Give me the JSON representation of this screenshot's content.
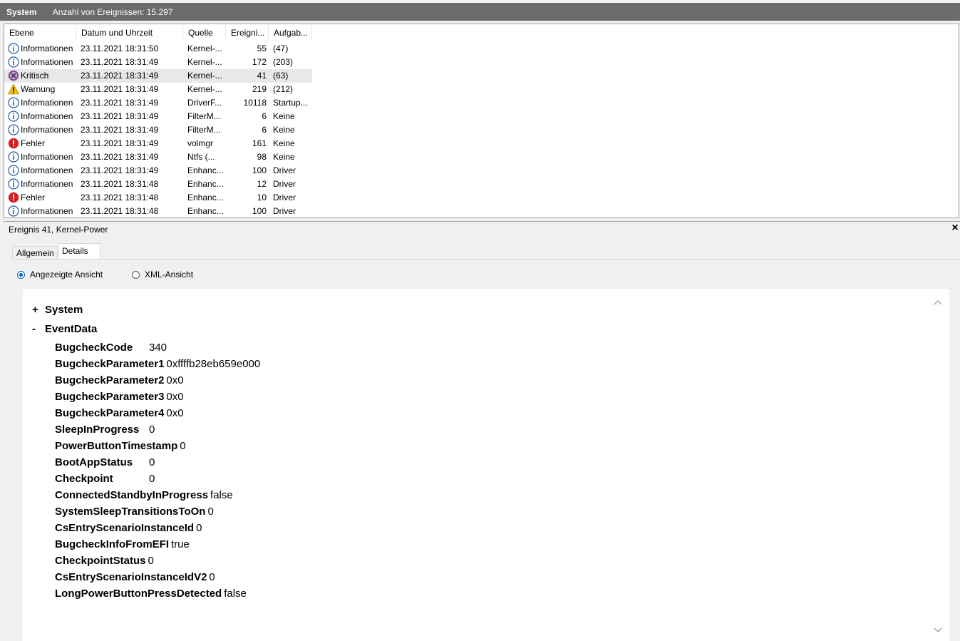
{
  "titlebar": {
    "name": "System",
    "count": "Anzahl von Ereignissen: 15.297"
  },
  "columns": [
    "Ebene",
    "Datum und Uhrzeit",
    "Quelle",
    "Ereigni...",
    "Aufgab..."
  ],
  "rows": [
    {
      "icon": "info-icon",
      "level": "Informationen",
      "date": "23.11.2021 18:31:50",
      "source": "Kernel-...",
      "id": "55",
      "task": "(47)"
    },
    {
      "icon": "info-icon",
      "level": "Informationen",
      "date": "23.11.2021 18:31:49",
      "source": "Kernel-...",
      "id": "172",
      "task": "(203)"
    },
    {
      "icon": "critical-icon",
      "level": "Kritisch",
      "date": "23.11.2021 18:31:49",
      "source": "Kernel-...",
      "id": "41",
      "task": "(63)",
      "selected": true
    },
    {
      "icon": "warning-icon",
      "level": "Warnung",
      "date": "23.11.2021 18:31:49",
      "source": "Kernel-...",
      "id": "219",
      "task": "(212)"
    },
    {
      "icon": "info-icon",
      "level": "Informationen",
      "date": "23.11.2021 18:31:49",
      "source": "DriverF...",
      "id": "10118",
      "task": "Startup..."
    },
    {
      "icon": "info-icon",
      "level": "Informationen",
      "date": "23.11.2021 18:31:49",
      "source": "FilterM...",
      "id": "6",
      "task": "Keine"
    },
    {
      "icon": "info-icon",
      "level": "Informationen",
      "date": "23.11.2021 18:31:49",
      "source": "FilterM...",
      "id": "6",
      "task": "Keine"
    },
    {
      "icon": "error-icon",
      "level": "Fehler",
      "date": "23.11.2021 18:31:49",
      "source": "volmgr",
      "id": "161",
      "task": "Keine"
    },
    {
      "icon": "info-icon",
      "level": "Informationen",
      "date": "23.11.2021 18:31:49",
      "source": "Ntfs (...",
      "id": "98",
      "task": "Keine"
    },
    {
      "icon": "info-icon",
      "level": "Informationen",
      "date": "23.11.2021 18:31:49",
      "source": "Enhanc...",
      "id": "100",
      "task": "Driver"
    },
    {
      "icon": "info-icon",
      "level": "Informationen",
      "date": "23.11.2021 18:31:48",
      "source": "Enhanc...",
      "id": "12",
      "task": "Driver"
    },
    {
      "icon": "error-icon",
      "level": "Fehler",
      "date": "23.11.2021 18:31:48",
      "source": "Enhanc...",
      "id": "10",
      "task": "Driver"
    },
    {
      "icon": "info-icon",
      "level": "Informationen",
      "date": "23.11.2021 18:31:48",
      "source": "Enhanc...",
      "id": "100",
      "task": "Driver"
    }
  ],
  "detail": {
    "title": "Ereignis 41, Kernel-Power",
    "close": "×",
    "tabs": {
      "general": "Allgemein",
      "details": "Details"
    },
    "view_options": {
      "shown": "Angezeigte Ansicht",
      "xml": "XML-Ansicht",
      "selected": "shown"
    },
    "sections": {
      "system": {
        "toggle": "+",
        "label": "System"
      },
      "eventdata": {
        "toggle": "-",
        "label": "EventData"
      }
    },
    "fields": [
      {
        "name": "BugcheckCode",
        "value": "340"
      },
      {
        "name": "BugcheckParameter1",
        "value": "0xffffb28eb659e000"
      },
      {
        "name": "BugcheckParameter2",
        "value": "0x0"
      },
      {
        "name": "BugcheckParameter3",
        "value": "0x0"
      },
      {
        "name": "BugcheckParameter4",
        "value": "0x0"
      },
      {
        "name": "SleepInProgress",
        "value": "0"
      },
      {
        "name": "PowerButtonTimestamp",
        "value": "0"
      },
      {
        "name": "BootAppStatus",
        "value": "0"
      },
      {
        "name": "Checkpoint",
        "value": "0"
      },
      {
        "name": "ConnectedStandbyInProgress",
        "value": "false"
      },
      {
        "name": "SystemSleepTransitionsToOn",
        "value": "0"
      },
      {
        "name": "CsEntryScenarioInstanceId",
        "value": "0"
      },
      {
        "name": "BugcheckInfoFromEFI",
        "value": "true"
      },
      {
        "name": "CheckpointStatus",
        "value": "0"
      },
      {
        "name": "CsEntryScenarioInstanceIdV2",
        "value": "0"
      },
      {
        "name": "LongPowerButtonPressDetected",
        "value": "false"
      }
    ]
  },
  "colors": {
    "titlebar_bg": "#6b6b6b",
    "info_blue": "#1e5aa8",
    "error_red": "#d42020",
    "warning_yellow": "#f2c200",
    "critical_purple": "#7a4f8f"
  }
}
